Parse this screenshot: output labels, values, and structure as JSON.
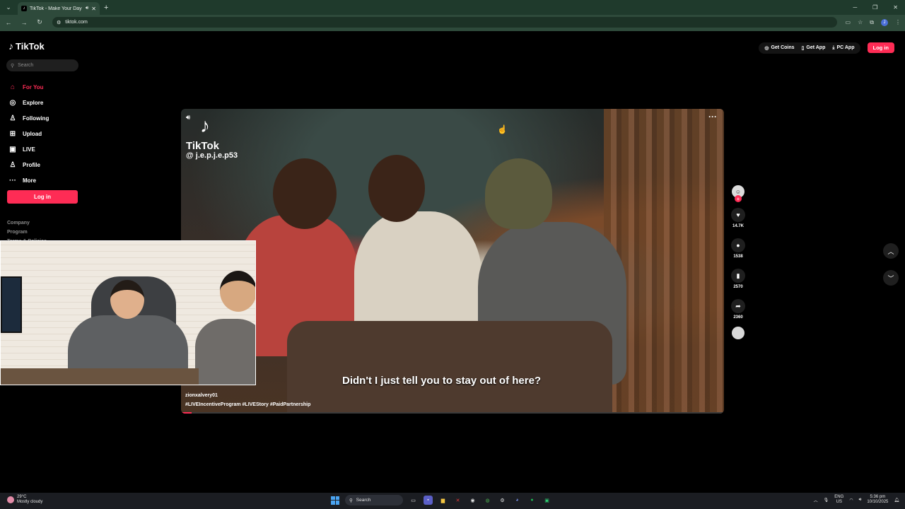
{
  "browser": {
    "tab_title": "TikTok - Make Your Day",
    "url": "tiktok.com",
    "profile_initial": "J"
  },
  "sidebar": {
    "logo": "TikTok",
    "search_placeholder": "Search",
    "items": [
      {
        "label": "For You",
        "icon": "home-icon",
        "active": true
      },
      {
        "label": "Explore",
        "icon": "compass-icon"
      },
      {
        "label": "Following",
        "icon": "user-icon"
      },
      {
        "label": "Upload",
        "icon": "plus-square-icon"
      },
      {
        "label": "LIVE",
        "icon": "live-tv-icon"
      },
      {
        "label": "Profile",
        "icon": "person-icon"
      },
      {
        "label": "More",
        "icon": "more-dots-icon"
      }
    ],
    "login_label": "Log in",
    "footer": [
      "Company",
      "Program",
      "Terms & Policies"
    ]
  },
  "header": {
    "get_coins": "Get Coins",
    "get_app": "Get App",
    "pc_app": "PC App",
    "login": "Log in"
  },
  "video": {
    "watermark_brand": "TikTok",
    "watermark_handle": "@ j.e.p.j.e.p53",
    "subtitle": "Didn't I just tell you to stay out of here?",
    "author": "zionxalvery01",
    "tags": "#LIVEIncentiveProgram  #LIVEStory  #PaidPartnership",
    "progress": 0.02
  },
  "actions": {
    "likes": "14.7K",
    "comments": "1538",
    "saves": "2570",
    "shares": "2360"
  },
  "taskbar": {
    "temp": "29°C",
    "weather": "Mostly cloudy",
    "search": "Search",
    "lang": "ENG",
    "region": "US",
    "time": "5:36 pm",
    "date": "10/10/2025"
  },
  "colors": {
    "accent": "#fe2c55",
    "browser_frame": "#1f3a2c"
  }
}
